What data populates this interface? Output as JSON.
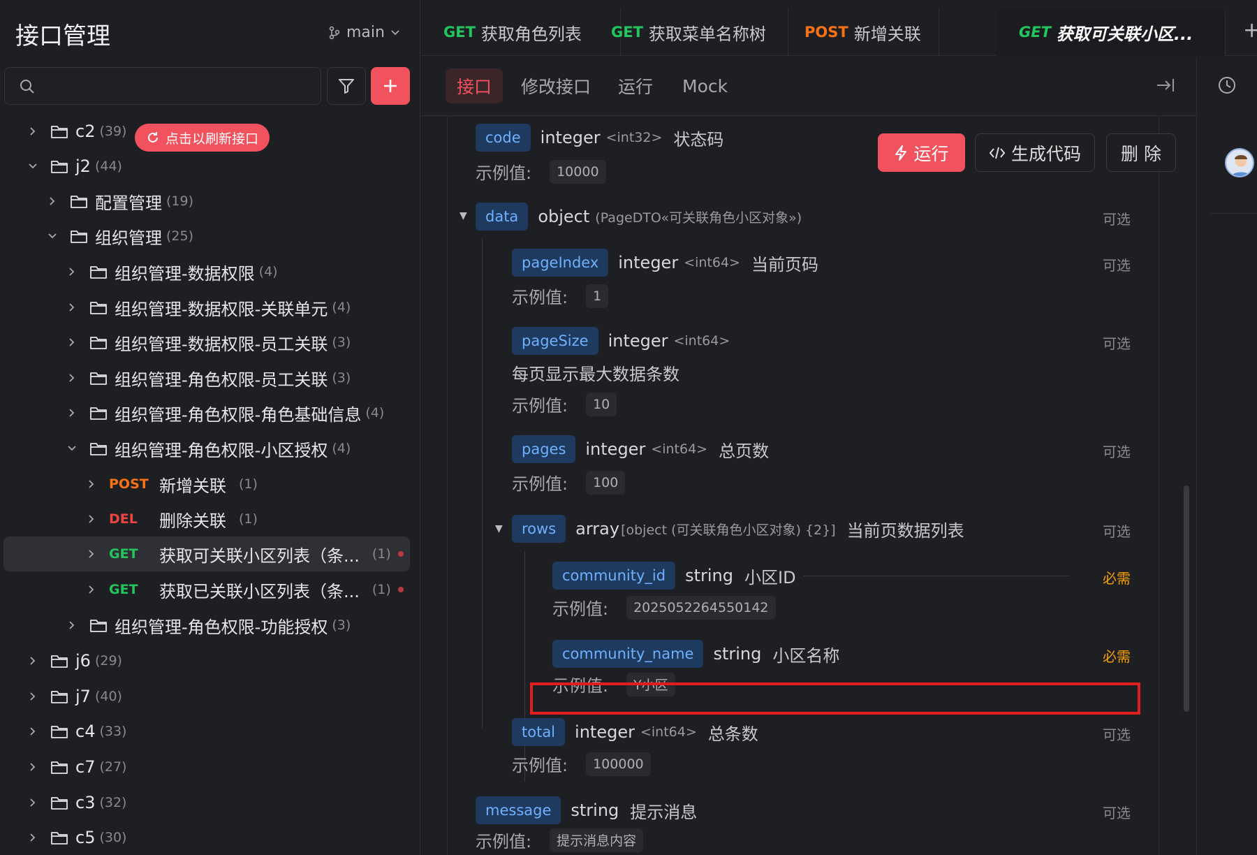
{
  "sidebar": {
    "title": "接口管理",
    "branch": "main",
    "search_placeholder": "",
    "refresh_label": "点击以刷新接口",
    "tree": [
      {
        "label": "c2",
        "count": "(39)",
        "type": "folder",
        "expanded": false
      },
      {
        "label": "j2",
        "count": "(44)",
        "type": "folder",
        "expanded": true
      },
      {
        "label": "配置管理",
        "count": "(19)",
        "type": "folder",
        "expanded": false
      },
      {
        "label": "组织管理",
        "count": "(25)",
        "type": "folder",
        "expanded": true
      },
      {
        "label": "组织管理-数据权限",
        "count": "(4)",
        "type": "folder",
        "expanded": false
      },
      {
        "label": "组织管理-数据权限-关联单元",
        "count": "(4)",
        "type": "folder",
        "expanded": false
      },
      {
        "label": "组织管理-数据权限-员工关联",
        "count": "(3)",
        "type": "folder",
        "expanded": false
      },
      {
        "label": "组织管理-角色权限-员工关联",
        "count": "(3)",
        "type": "folder",
        "expanded": false
      },
      {
        "label": "组织管理-角色权限-角色基础信息",
        "count": "(4)",
        "type": "folder",
        "expanded": false
      },
      {
        "label": "组织管理-角色权限-小区授权",
        "count": "(4)",
        "type": "folder",
        "expanded": true
      },
      {
        "label": "新增关联",
        "count": "(1)",
        "type": "api",
        "method": "POST"
      },
      {
        "label": "删除关联",
        "count": "(1)",
        "type": "api",
        "method": "DEL"
      },
      {
        "label": "获取可关联小区列表（条...",
        "count": "(1)",
        "type": "api",
        "method": "GET",
        "selected": true
      },
      {
        "label": "获取已关联小区列表（条...",
        "count": "(1)",
        "type": "api",
        "method": "GET"
      },
      {
        "label": "组织管理-角色权限-功能授权",
        "count": "(3)",
        "type": "folder",
        "expanded": false
      },
      {
        "label": "j6",
        "count": "(29)",
        "type": "folder",
        "expanded": false
      },
      {
        "label": "j7",
        "count": "(40)",
        "type": "folder",
        "expanded": false
      },
      {
        "label": "c4",
        "count": "(33)",
        "type": "folder",
        "expanded": false
      },
      {
        "label": "c7",
        "count": "(27)",
        "type": "folder",
        "expanded": false
      },
      {
        "label": "c3",
        "count": "(32)",
        "type": "folder",
        "expanded": false
      },
      {
        "label": "c5",
        "count": "(30)",
        "type": "folder",
        "expanded": false
      }
    ]
  },
  "tabs": [
    {
      "method": "GET",
      "label": "获取角色列表"
    },
    {
      "method": "GET",
      "label": "获取菜单名称树"
    },
    {
      "method": "POST",
      "label": "新增关联"
    },
    {
      "method": "GET",
      "label": "获取可关联小区...",
      "active": true
    }
  ],
  "subtabs": {
    "api": "接口",
    "edit": "修改接口",
    "run": "运行",
    "mock": "Mock"
  },
  "actions": {
    "run": "运行",
    "gen_code": "生成代码",
    "delete": "删 除"
  },
  "labels": {
    "example": "示例值:",
    "optional": "可选",
    "required": "必需"
  },
  "fields": {
    "code": {
      "name": "code",
      "type": "integer",
      "fmt": "<int32>",
      "desc": "状态码",
      "example": "10000"
    },
    "data": {
      "name": "data",
      "type": "object",
      "fmt": "(PageDTO«可关联角色小区对象»)"
    },
    "pageIndex": {
      "name": "pageIndex",
      "type": "integer",
      "fmt": "<int64>",
      "desc": "当前页码",
      "example": "1"
    },
    "pageSize": {
      "name": "pageSize",
      "type": "integer",
      "fmt": "<int64>",
      "desc": "每页显示最大数据条数",
      "example": "10"
    },
    "pages": {
      "name": "pages",
      "type": "integer",
      "fmt": "<int64>",
      "desc": "总页数",
      "example": "100"
    },
    "rows": {
      "name": "rows",
      "type": "array",
      "fmt": "[object (可关联角色小区对象) {2}]",
      "desc": "当前页数据列表"
    },
    "community_id": {
      "name": "community_id",
      "type": "string",
      "desc": "小区ID",
      "example": "2025052264550142"
    },
    "community_name": {
      "name": "community_name",
      "type": "string",
      "desc": "小区名称",
      "example": "Y小区"
    },
    "total": {
      "name": "total",
      "type": "integer",
      "fmt": "<int64>",
      "desc": "总条数",
      "example": "100000"
    },
    "message": {
      "name": "message",
      "type": "string",
      "desc": "提示消息",
      "example": "提示消息内容"
    }
  },
  "colors": {
    "accent": "#f2525d",
    "get": "#22c55e",
    "post": "#f97316",
    "del": "#ef4444",
    "field_name": "#6fb0ff",
    "required": "#f59e0b",
    "highlight": "#e11d1d"
  }
}
